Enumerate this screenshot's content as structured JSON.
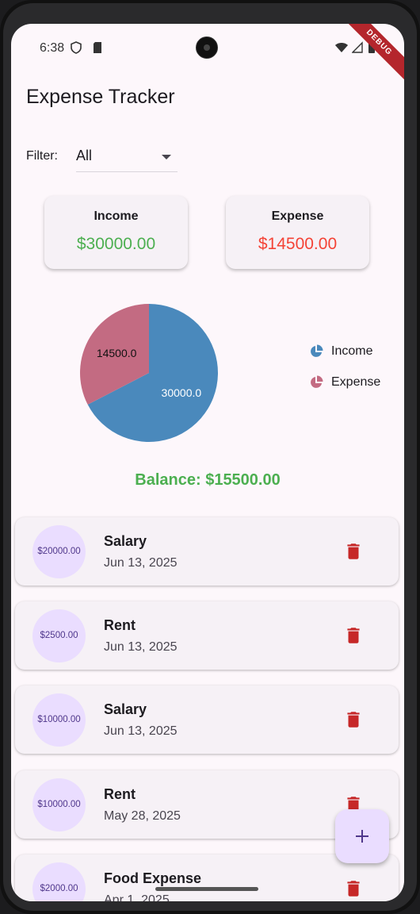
{
  "status_bar": {
    "time": "6:38",
    "debug_banner": "DEBUG",
    "icons": [
      "shield-icon",
      "sim-card-icon",
      "wifi-icon",
      "signal-icon",
      "battery-icon"
    ]
  },
  "app": {
    "title": "Expense Tracker"
  },
  "filter": {
    "label": "Filter:",
    "selected": "All"
  },
  "summary": {
    "income": {
      "label": "Income",
      "value": "$30000.00",
      "color": "#4caf50"
    },
    "expense": {
      "label": "Expense",
      "value": "$14500.00",
      "color": "#f44336"
    }
  },
  "chart_data": {
    "type": "pie",
    "slices": [
      {
        "name": "Income",
        "value": 30000.0,
        "label": "30000.0",
        "color": "#4a89bc"
      },
      {
        "name": "Expense",
        "value": 14500.0,
        "label": "14500.0",
        "color": "#c36b82"
      }
    ],
    "legend": [
      "Income",
      "Expense"
    ],
    "legend_position": "right"
  },
  "balance": "Balance: $15500.00",
  "transactions": [
    {
      "amount": "$20000.00",
      "title": "Salary",
      "date": "Jun 13, 2025"
    },
    {
      "amount": "$2500.00",
      "title": "Rent",
      "date": "Jun 13, 2025"
    },
    {
      "amount": "$10000.00",
      "title": "Salary",
      "date": "Jun 13, 2025"
    },
    {
      "amount": "$10000.00",
      "title": "Rent",
      "date": "May 28, 2025"
    },
    {
      "amount": "$2000.00",
      "title": "Food Expense",
      "date": "Apr 1, 2025"
    }
  ],
  "colors": {
    "delete_icon": "#c62828",
    "avatar_bg": "#eaddff",
    "fab_bg": "#eaddff"
  }
}
